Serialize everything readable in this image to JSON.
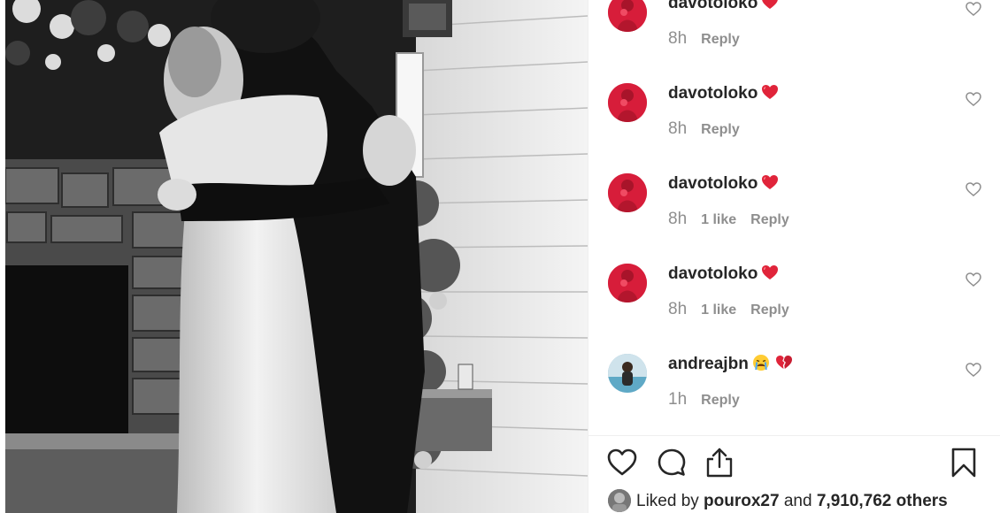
{
  "post": {
    "photo_alt": "photo",
    "comments": [
      {
        "username": "davotoloko",
        "emojis": [
          "red-heart"
        ],
        "time": "8h",
        "likes": "",
        "reply_label": "Reply",
        "avatar_color": "#d71d3a"
      },
      {
        "username": "davotoloko",
        "emojis": [
          "red-heart"
        ],
        "time": "8h",
        "likes": "",
        "reply_label": "Reply",
        "avatar_color": "#d71d3a"
      },
      {
        "username": "davotoloko",
        "emojis": [
          "red-heart"
        ],
        "time": "8h",
        "likes": "1 like",
        "reply_label": "Reply",
        "avatar_color": "#d71d3a"
      },
      {
        "username": "davotoloko",
        "emojis": [
          "red-heart"
        ],
        "time": "8h",
        "likes": "1 like",
        "reply_label": "Reply",
        "avatar_color": "#d71d3a"
      },
      {
        "username": "andreajbn",
        "emojis": [
          "crying-face",
          "broken-heart"
        ],
        "time": "1h",
        "likes": "",
        "reply_label": "Reply",
        "avatar_color": "#7fb2c8"
      }
    ],
    "actions": {
      "like_icon": "heart-outline-icon",
      "comment_icon": "comment-bubble-icon",
      "share_icon": "share-upload-icon",
      "save_icon": "bookmark-icon"
    },
    "liked_by": {
      "prefix": "Liked by ",
      "user": "pourox27",
      "middle": " and ",
      "count": "7,910,762 others"
    }
  },
  "colors": {
    "text": "#262626",
    "secondary": "#8e8e8e",
    "heart_red": "#ed4956",
    "divider": "#efefef"
  }
}
